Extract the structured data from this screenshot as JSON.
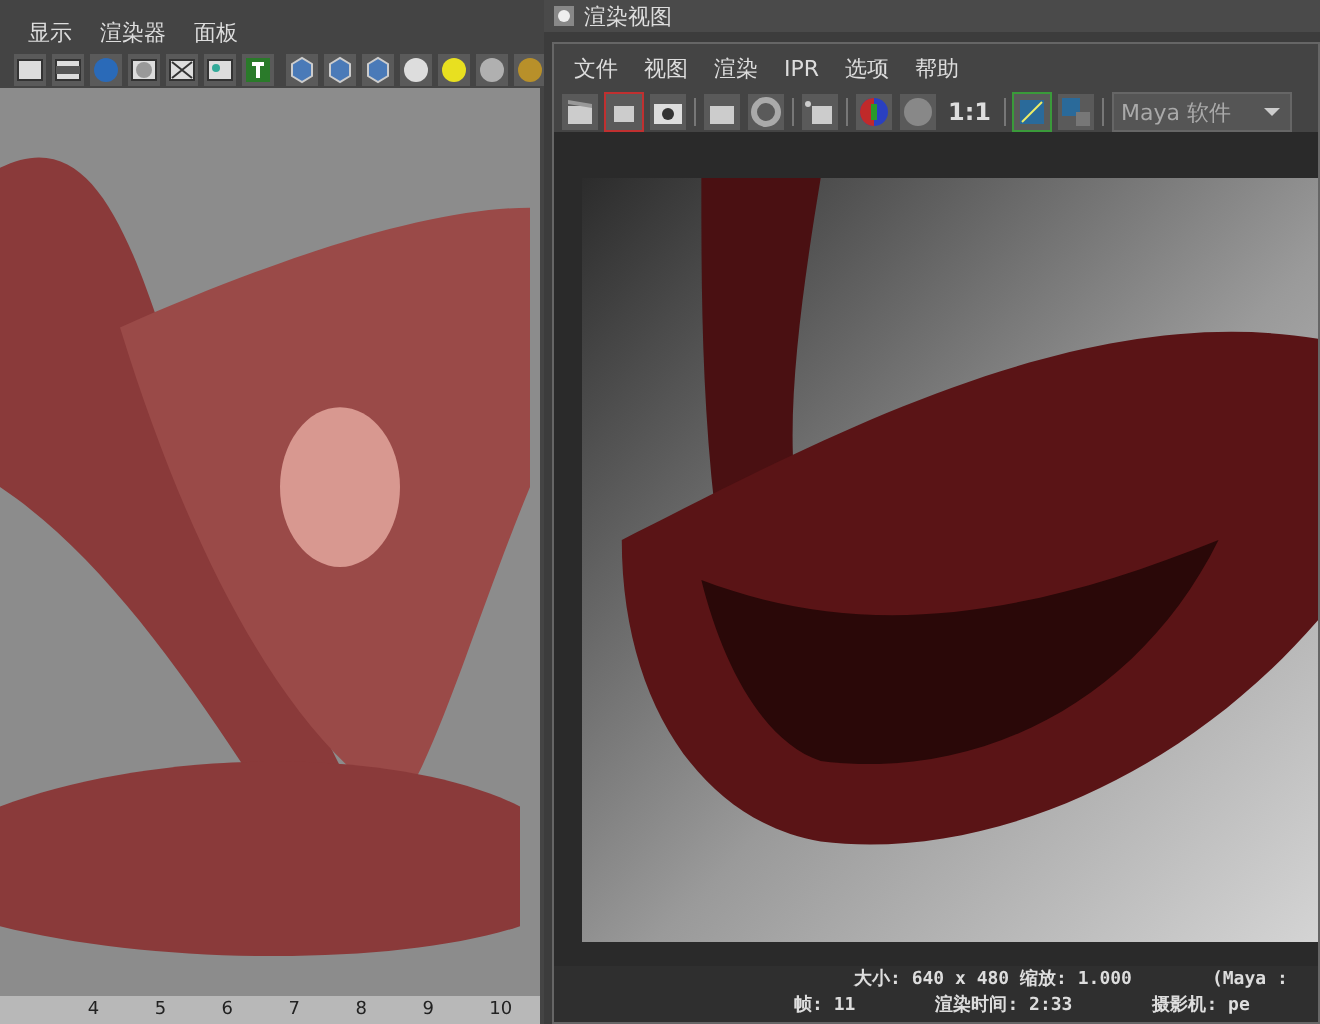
{
  "viewport": {
    "menu": [
      "显示",
      "渲染器",
      "面板"
    ],
    "timeline_ticks": [
      "4",
      "5",
      "6",
      "7",
      "8",
      "9",
      "10"
    ]
  },
  "render_view": {
    "title": "渲染视图",
    "menu": [
      "文件",
      "视图",
      "渲染",
      "IPR",
      "选项",
      "帮助"
    ],
    "zoom_label": "1:1",
    "renderer": "Maya 软件",
    "status_lines": [
      [
        "大小: 640 x 480 缩放: 1.000",
        "(Maya :"
      ],
      [
        "帧: 11",
        "渲染时间: 2:33",
        "摄影机: pe"
      ]
    ]
  }
}
